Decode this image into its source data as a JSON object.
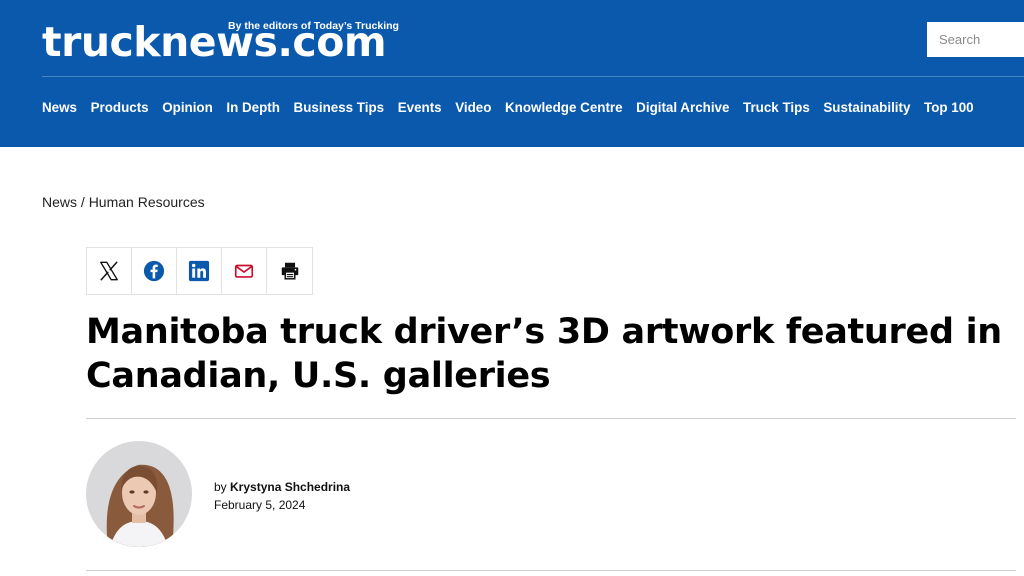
{
  "brand": {
    "logo_text": "trucknews.com",
    "tagline": "By the editors of Today’s Trucking",
    "header_color": "#0a59ad"
  },
  "search": {
    "placeholder": "Search"
  },
  "nav": {
    "items": [
      {
        "label": "News"
      },
      {
        "label": "Products"
      },
      {
        "label": "Opinion"
      },
      {
        "label": "In Depth"
      },
      {
        "label": "Business Tips"
      },
      {
        "label": "Events"
      },
      {
        "label": "Video"
      },
      {
        "label": "Knowledge Centre"
      },
      {
        "label": "Digital Archive"
      },
      {
        "label": "Truck Tips"
      },
      {
        "label": "Sustainability"
      },
      {
        "label": "Top 100"
      }
    ]
  },
  "breadcrumb": {
    "section": "News",
    "separator": " / ",
    "category": "Human Resources"
  },
  "share": {
    "icons": [
      "x-icon",
      "facebook-icon",
      "linkedin-icon",
      "email-icon",
      "print-icon"
    ]
  },
  "article": {
    "title": "Manitoba truck driver’s 3D artwork featured in Canadian, U.S. galleries",
    "by_prefix": "by ",
    "author": "Krystyna Shchedrina",
    "date": "February 5, 2024"
  }
}
